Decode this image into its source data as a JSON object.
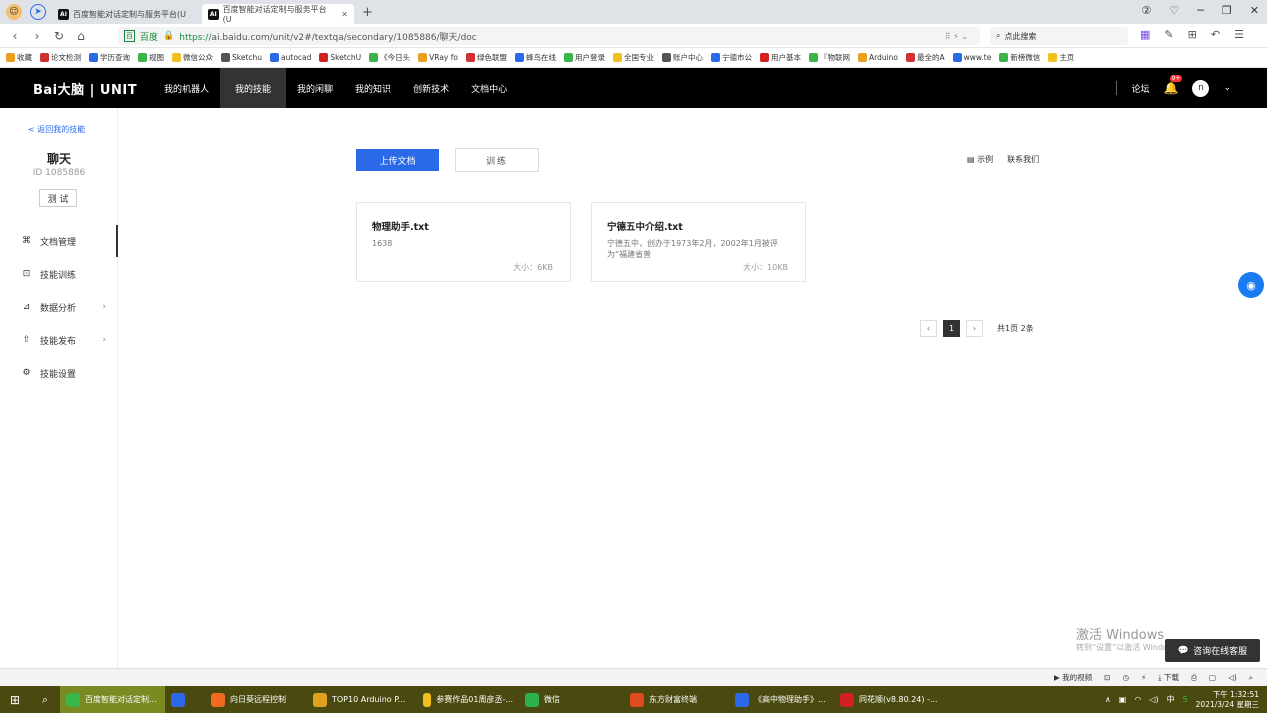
{
  "browser": {
    "tabs": [
      {
        "label": "百度智能对话定制与服务平台(U",
        "active": false
      },
      {
        "label": "百度智能对话定制与服务平台(U",
        "active": true
      }
    ],
    "new_tab": "+",
    "url_site": "百度",
    "url_https": "https://",
    "url_rest": "ai.baidu.com/unit/v2#/textqa/secondary/1085886/聊天/doc",
    "search_placeholder": "点此搜索",
    "bookmarks": [
      "收藏",
      "论文检测",
      "学历查询",
      "规图",
      "微信公众",
      "Sketchu",
      "autocad",
      "SketchU",
      "《今日头",
      "VRay fo",
      "绿色联盟",
      "蜂鸟在线",
      "用户登录",
      "全国专业",
      "账户中心",
      "宁德市公",
      "用户基本",
      "『物联网",
      "Arduino",
      "最全的A",
      "www.te",
      "新榜微信",
      "主页"
    ]
  },
  "topnav": {
    "logo": "Bai大脑 | UNIT",
    "items": [
      "我的机器人",
      "我的技能",
      "我的闲聊",
      "我的知识",
      "创新技术",
      "文档中心"
    ],
    "active_index": 1,
    "forum": "论坛",
    "badge": "9+",
    "avatar": "n",
    "chevron": "⌄"
  },
  "sidebar": {
    "back": "< 返回我的技能",
    "skill_name": "聊天",
    "skill_id": "ID 1085886",
    "test": "测 试",
    "menu": [
      {
        "label": "文档管理",
        "icon": "document-manage-icon",
        "glyph": "⌘",
        "arrow": ""
      },
      {
        "label": "技能训练",
        "icon": "training-icon",
        "glyph": "⊡",
        "arrow": ""
      },
      {
        "label": "数据分析",
        "icon": "chart-icon",
        "glyph": "⊿",
        "arrow": "›"
      },
      {
        "label": "技能发布",
        "icon": "upload-icon",
        "glyph": "⇧",
        "arrow": "›"
      },
      {
        "label": "技能设置",
        "icon": "gear-icon",
        "glyph": "⚙",
        "arrow": ""
      }
    ]
  },
  "main": {
    "upload_label": "上传文档",
    "train_label": "训练",
    "example_label": "示例",
    "contact_label": "联系我们",
    "cards": [
      {
        "title": "物理助手.txt",
        "desc": "1638",
        "size": "大小：6KB"
      },
      {
        "title": "宁德五中介绍.txt",
        "desc": "宁德五中，创办于1973年2月，2002年1月被评为“福建省普",
        "size": "大小：10KB"
      }
    ],
    "pager": {
      "prev": "‹",
      "current": "1",
      "next": "›",
      "summary": "共1页  2条"
    }
  },
  "overlay": {
    "watermark": "激活 Windows",
    "watermark_sub": "转到“设置”以激活 Windows。",
    "support": "咨询在线客服"
  },
  "statusbar": [
    "我的视频",
    "下载"
  ],
  "taskbar": {
    "items": [
      {
        "label": "百度智能对话定制...",
        "color": "#3ab54a",
        "active": true
      },
      {
        "label": "",
        "color": "#2a6ae8",
        "active": false
      },
      {
        "label": "向日葵远程控制",
        "color": "#f06a20",
        "active": false
      },
      {
        "label": "TOP10 Arduino P...",
        "color": "#e0a020",
        "active": false
      },
      {
        "label": "参赛作品01周彦丞-...",
        "color": "#f0c020",
        "active": false
      },
      {
        "label": "微信",
        "color": "#2ab24a",
        "active": false
      },
      {
        "label": "东方财富终端",
        "color": "#e04a20",
        "active": false
      },
      {
        "label": "《高中物理助手》...",
        "color": "#2a6ae8",
        "active": false
      },
      {
        "label": "同花顺(v8.80.24) -...",
        "color": "#d02020",
        "active": false
      }
    ],
    "ime": "中",
    "time": "下午 1:32:51",
    "date": "2021/3/24 星期三"
  }
}
